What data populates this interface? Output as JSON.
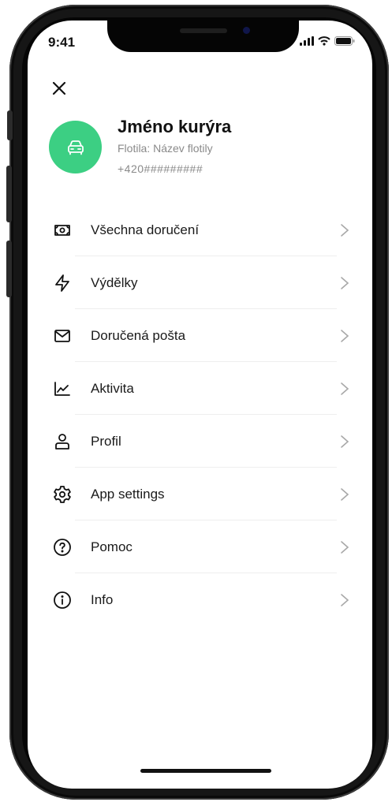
{
  "status_bar": {
    "time": "9:41"
  },
  "header": {
    "courier_name": "Jméno kurýra",
    "fleet": "Flotila: Název flotily",
    "phone": "+420#########"
  },
  "colors": {
    "accent": "#3ccf83"
  },
  "menu": {
    "items": [
      {
        "label": "Všechna doručení",
        "icon": "money-icon"
      },
      {
        "label": "Výdělky",
        "icon": "lightning-icon"
      },
      {
        "label": "Doručená pošta",
        "icon": "mail-icon"
      },
      {
        "label": "Aktivita",
        "icon": "chart-line-icon"
      },
      {
        "label": "Profil",
        "icon": "user-icon"
      },
      {
        "label": "App settings",
        "icon": "gear-icon"
      },
      {
        "label": "Pomoc",
        "icon": "help-icon"
      },
      {
        "label": "Info",
        "icon": "info-icon"
      }
    ]
  }
}
